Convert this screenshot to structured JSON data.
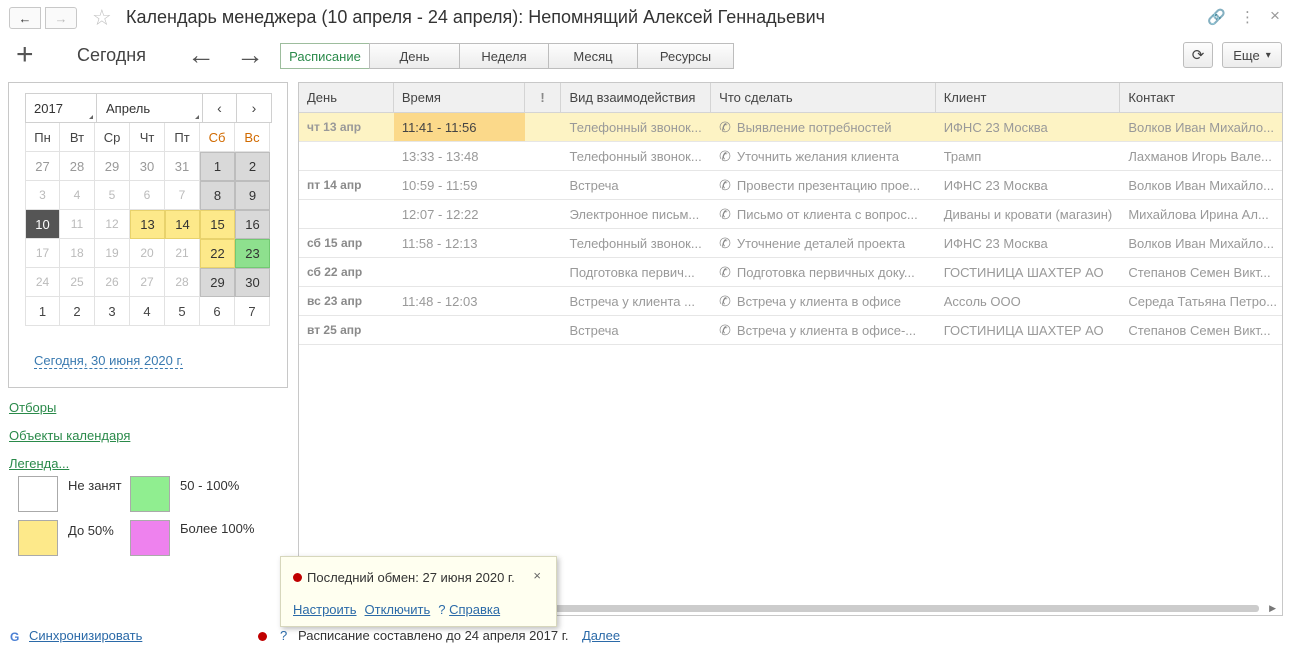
{
  "window": {
    "title": "Календарь менеджера (10 апреля - 24 апреля): Непомнящий Алексей Геннадьевич",
    "back_icon": "←",
    "forward_icon": "→",
    "star_icon": "☆",
    "link_icon": "🔗",
    "more_icon": "⋮",
    "close_icon": "×"
  },
  "toolbar": {
    "add_icon": "+",
    "today_label": "Сегодня",
    "prev_icon": "←",
    "next_icon": "→",
    "tabs": [
      "Расписание",
      "День",
      "Неделя",
      "Месяц",
      "Ресурсы"
    ],
    "active_tab": "Расписание",
    "refresh_icon": "⟳",
    "more_label": "Еще",
    "more_caret": "▾"
  },
  "calendar": {
    "year": "2017",
    "month": "Апрель",
    "prev_icon": "‹",
    "next_icon": "›",
    "weekdays": [
      "Пн",
      "Вт",
      "Ср",
      "Чт",
      "Пт",
      "Сб",
      "Вс"
    ],
    "weeks": [
      [
        "27",
        "28",
        "29",
        "30",
        "31",
        "1",
        "2"
      ],
      [
        "3",
        "4",
        "5",
        "6",
        "7",
        "8",
        "9"
      ],
      [
        "10",
        "11",
        "12",
        "13",
        "14",
        "15",
        "16"
      ],
      [
        "17",
        "18",
        "19",
        "20",
        "21",
        "22",
        "23"
      ],
      [
        "24",
        "25",
        "26",
        "27",
        "28",
        "29",
        "30"
      ],
      [
        "1",
        "2",
        "3",
        "4",
        "5",
        "6",
        "7"
      ]
    ],
    "today_link": "Сегодня, 30 июня 2020 г."
  },
  "sidebar": {
    "filters_link": "Отборы",
    "calendar_objects_link": "Объекты календаря",
    "legend_link": "Легенда...",
    "legend": [
      {
        "label": "Не занят",
        "color": "#ffffff"
      },
      {
        "label": "50 - 100%",
        "color": "#90ee90"
      },
      {
        "label": "До 50%",
        "color": "#fde98a"
      },
      {
        "label": "Более 100%",
        "color": "#ee82ee"
      }
    ]
  },
  "table": {
    "columns": [
      "День",
      "Время",
      "!",
      "Вид взаимодействия",
      "Что сделать",
      "Клиент",
      "Контакт"
    ],
    "rows": [
      {
        "day": "чт 13 апр",
        "time": "11:41 - 11:56",
        "type": "Телефонный звонок...",
        "task": "Выявление потребностей",
        "client": "ИФНС 23 Москва",
        "contact": "Волков Иван Михайло..."
      },
      {
        "day": "",
        "time": "13:33 - 13:48",
        "type": "Телефонный звонок...",
        "task": "Уточнить желания клиента",
        "client": "Трамп",
        "contact": "Лахманов Игорь Вале..."
      },
      {
        "day": "пт 14 апр",
        "time": "10:59 - 11:59",
        "type": "Встреча",
        "task": "Провести презентацию прое...",
        "client": "ИФНС 23 Москва",
        "contact": "Волков Иван Михайло..."
      },
      {
        "day": "",
        "time": "12:07 - 12:22",
        "type": "Электронное письм...",
        "task": "Письмо от клиента с вопрос...",
        "client": "Диваны и кровати (магазин)",
        "contact": "Михайлова Ирина Ал..."
      },
      {
        "day": "сб 15 апр",
        "time": "11:58 - 12:13",
        "type": "Телефонный звонок...",
        "task": "Уточнение деталей проекта",
        "client": "ИФНС 23 Москва",
        "contact": "Волков Иван Михайло..."
      },
      {
        "day": "сб 22 апр",
        "time": "",
        "type": "Подготовка первич...",
        "task": "Подготовка первичных доку...",
        "client": "ГОСТИНИЦА ШАХТЕР АО",
        "contact": "Степанов Семен Викт..."
      },
      {
        "day": "вс 23 апр",
        "time": "11:48 - 12:03",
        "type": "Встреча у клиента ...",
        "task": "Встреча у клиента в офисе",
        "client": "Ассоль ООО",
        "contact": "Середа Татьяна Петро..."
      },
      {
        "day": "вт 25 апр",
        "time": "",
        "type": "Встреча",
        "task": "Встреча у клиента в офисе-...",
        "client": "ГОСТИНИЦА ШАХТЕР АО",
        "contact": "Степанов Семен Викт..."
      }
    ],
    "phone_icon": "✆"
  },
  "popup": {
    "message": "Последний обмен: 27 июня 2020 г.",
    "close_icon": "×",
    "configure_link": "Настроить",
    "disable_link": "Отключить",
    "help_mark": "?",
    "help_link": "Справка"
  },
  "statusbar": {
    "google_icon": "G",
    "sync_link": "Синхронизировать",
    "help_mark": "?",
    "schedule_text": "Расписание составлено до 24 апреля 2017 г.",
    "more_link": "Далее"
  }
}
